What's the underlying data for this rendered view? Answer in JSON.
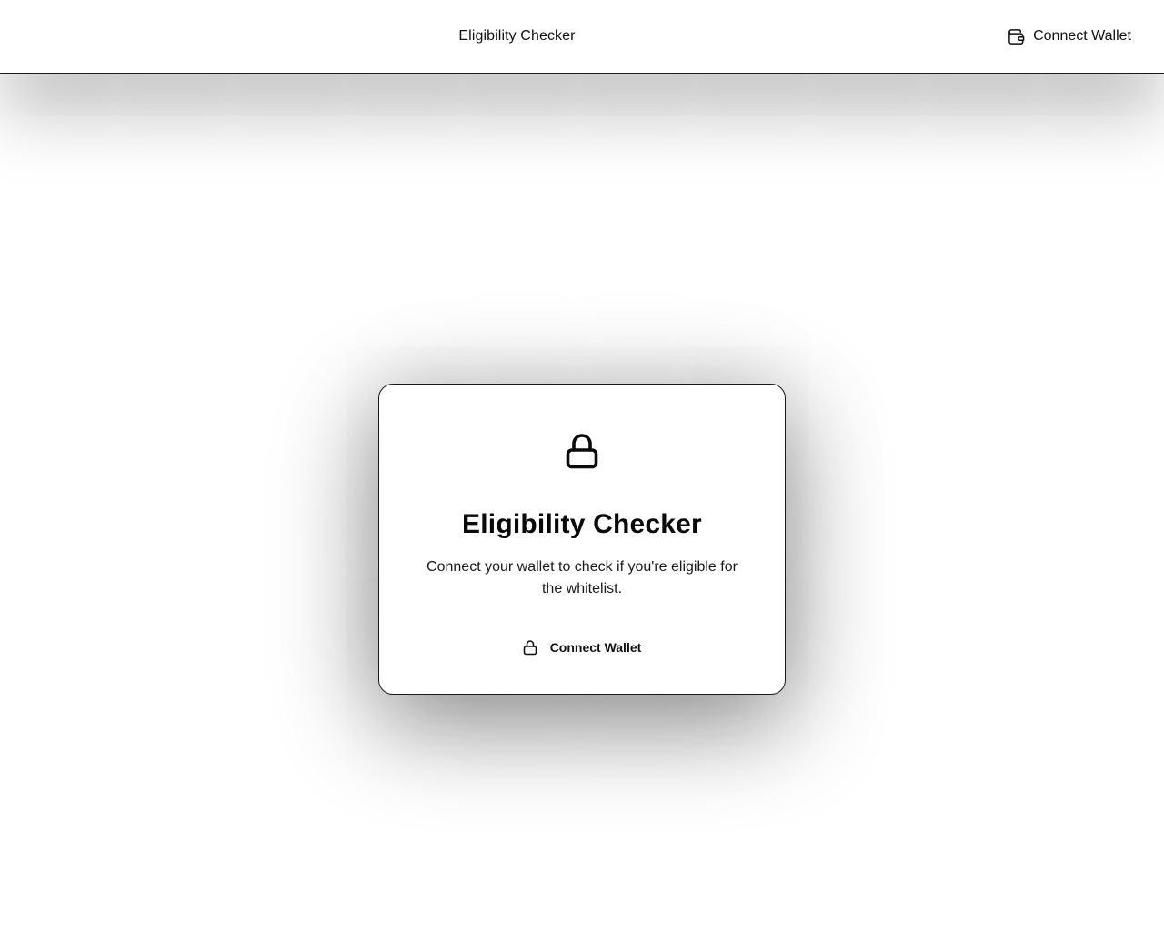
{
  "header": {
    "title": "Eligibility Checker",
    "connect_label": "Connect Wallet",
    "connect_icon": "wallet-icon"
  },
  "card": {
    "icon": "lock-icon",
    "title": "Eligibility Checker",
    "description": "Connect your wallet to check if you're eligible for the whitelist.",
    "button_label": "Connect Wallet",
    "button_icon": "lock-icon"
  },
  "colors": {
    "background": "#ffffff",
    "text": "#111111",
    "border": "#1a1a1a"
  }
}
